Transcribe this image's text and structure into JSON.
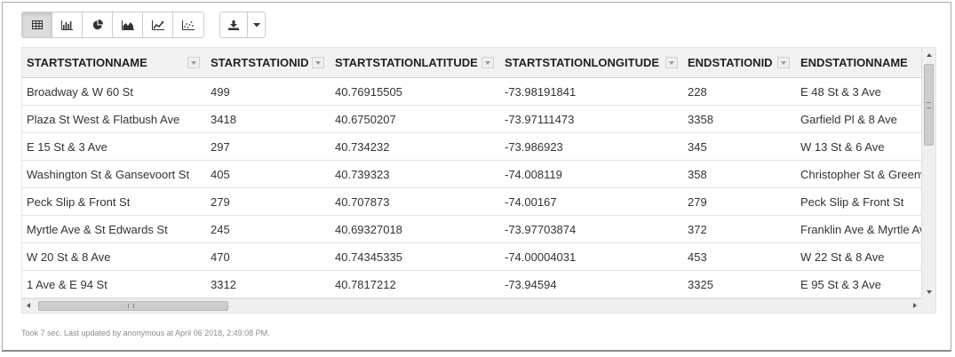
{
  "toolbar": {
    "viz_buttons": [
      {
        "name": "table-view-button",
        "icon": "table-icon",
        "active": true
      },
      {
        "name": "bar-chart-button",
        "icon": "bar-chart-icon",
        "active": false
      },
      {
        "name": "pie-chart-button",
        "icon": "pie-chart-icon",
        "active": false
      },
      {
        "name": "area-chart-button",
        "icon": "area-chart-icon",
        "active": false
      },
      {
        "name": "line-chart-button",
        "icon": "line-chart-icon",
        "active": false
      },
      {
        "name": "scatter-chart-button",
        "icon": "scatter-chart-icon",
        "active": false
      }
    ],
    "download_icon": "download-icon",
    "download_caret_icon": "caret-down-icon"
  },
  "table": {
    "columns": [
      "STARTSTATIONNAME",
      "STARTSTATIONID",
      "STARTSTATIONLATITUDE",
      "STARTSTATIONLONGITUDE",
      "ENDSTATIONID",
      "ENDSTATIONNAME"
    ],
    "rows": [
      [
        "Broadway & W 60 St",
        "499",
        "40.76915505",
        "-73.98191841",
        "228",
        "E 48 St & 3 Ave"
      ],
      [
        "Plaza St West & Flatbush Ave",
        "3418",
        "40.6750207",
        "-73.97111473",
        "3358",
        "Garfield Pl & 8 Ave"
      ],
      [
        "E 15 St & 3 Ave",
        "297",
        "40.734232",
        "-73.986923",
        "345",
        "W 13 St & 6 Ave"
      ],
      [
        "Washington St & Gansevoort St",
        "405",
        "40.739323",
        "-74.008119",
        "358",
        "Christopher St & Greenwich St"
      ],
      [
        "Peck Slip & Front St",
        "279",
        "40.707873",
        "-74.00167",
        "279",
        "Peck Slip & Front St"
      ],
      [
        "Myrtle Ave & St Edwards St",
        "245",
        "40.69327018",
        "-73.97703874",
        "372",
        "Franklin Ave & Myrtle Ave"
      ],
      [
        "W 20 St & 8 Ave",
        "470",
        "40.74345335",
        "-74.00004031",
        "453",
        "W 22 St & 8 Ave"
      ],
      [
        "1 Ave & E 94 St",
        "3312",
        "40.7817212",
        "-73.94594",
        "3325",
        "E 95 St & 3 Ave"
      ]
    ]
  },
  "colors": {
    "header_bg": "#f2f2f2",
    "active_button_bg": "#dcdcdc",
    "row_border": "#e2e2e2",
    "status_text": "#8c8c8c"
  },
  "status": "Took 7 sec. Last updated by anonymous at April 06 2018, 2:49:08 PM."
}
